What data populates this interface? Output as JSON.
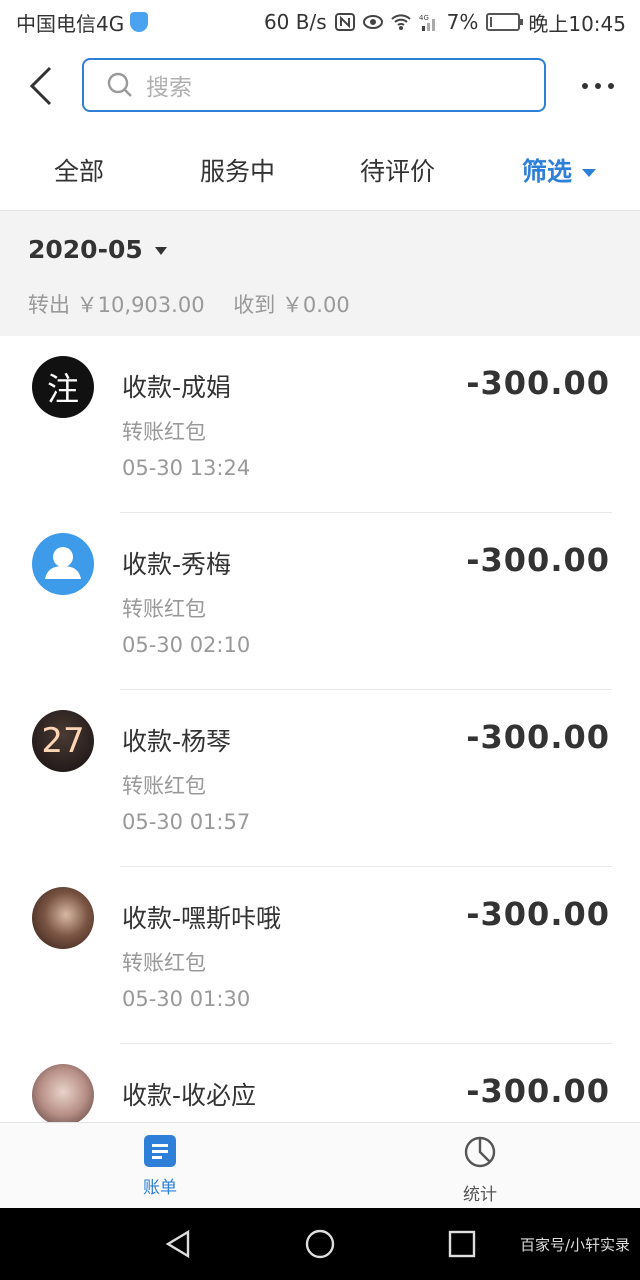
{
  "status_bar": {
    "carrier": "中国电信4G",
    "speed": "60 B/s",
    "signal_label": "4G",
    "battery": "7%",
    "battery_level": 0.07,
    "time": "晚上10:45"
  },
  "search": {
    "placeholder": "搜索"
  },
  "tabs": [
    {
      "label": "全部"
    },
    {
      "label": "服务中"
    },
    {
      "label": "待评价"
    },
    {
      "label": "筛选"
    }
  ],
  "month": {
    "label": "2020-05",
    "out": "转出 ￥10,903.00",
    "in": "收到 ￥0.00"
  },
  "transactions": [
    {
      "title": "收款-成娟",
      "type": "转账红包",
      "time": "05-30  13:24",
      "amount": "-300.00",
      "avatar_text": "注"
    },
    {
      "title": "收款-秀梅",
      "type": "转账红包",
      "time": "05-30  02:10",
      "amount": "-300.00",
      "avatar_text": ""
    },
    {
      "title": "收款-杨琴",
      "type": "转账红包",
      "time": "05-30  01:57",
      "amount": "-300.00",
      "avatar_text": "27"
    },
    {
      "title": "收款-嘿斯咔哦",
      "type": "转账红包",
      "time": "05-30  01:30",
      "amount": "-300.00",
      "avatar_text": ""
    },
    {
      "title": "收款-收必应",
      "type": "",
      "time": "",
      "amount": "-300.00",
      "avatar_text": ""
    }
  ],
  "bottom_nav": {
    "bill": "账单",
    "stats": "统计"
  },
  "watermark": "百家号/小轩实录",
  "colors": {
    "accent": "#2e7fd8",
    "panel": "#f3f3f3"
  }
}
